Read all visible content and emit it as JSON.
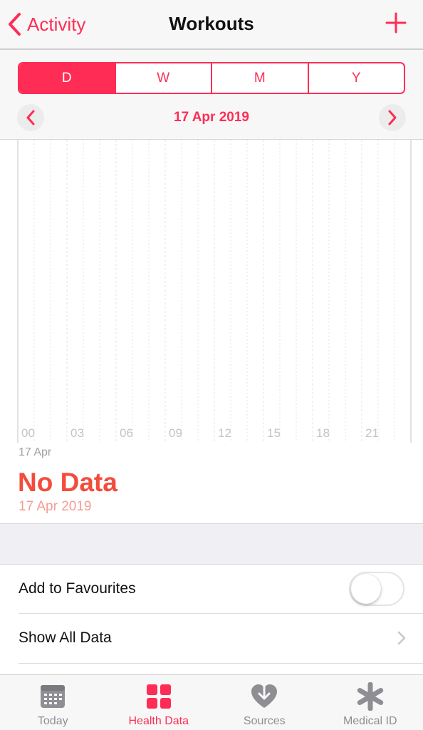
{
  "nav": {
    "back_label": "Activity",
    "title": "Workouts"
  },
  "segments": [
    {
      "label": "D",
      "active": true
    },
    {
      "label": "W",
      "active": false
    },
    {
      "label": "M",
      "active": false
    },
    {
      "label": "Y",
      "active": false
    }
  ],
  "date_nav": {
    "current_date": "17 Apr 2019"
  },
  "chart_data": {
    "type": "bar",
    "x_ticks": [
      "00",
      "03",
      "06",
      "09",
      "12",
      "15",
      "18",
      "21"
    ],
    "series": [],
    "grid": true
  },
  "summary": {
    "chart_date": "17 Apr",
    "value": "No Data",
    "date": "17 Apr 2019"
  },
  "settings": {
    "favourites_label": "Add to Favourites",
    "favourites_on": false,
    "show_all_label": "Show All Data"
  },
  "tabbar": {
    "tabs": [
      {
        "label": "Today",
        "icon": "calendar-icon",
        "active": false
      },
      {
        "label": "Health Data",
        "icon": "grid-icon",
        "active": true
      },
      {
        "label": "Sources",
        "icon": "sources-icon",
        "active": false
      },
      {
        "label": "Medical ID",
        "icon": "asterisk-icon",
        "active": false
      }
    ]
  },
  "colors": {
    "accent": "#ff2d55",
    "no_data": "#f24c3d",
    "inactive_tab": "#8e8e93"
  }
}
